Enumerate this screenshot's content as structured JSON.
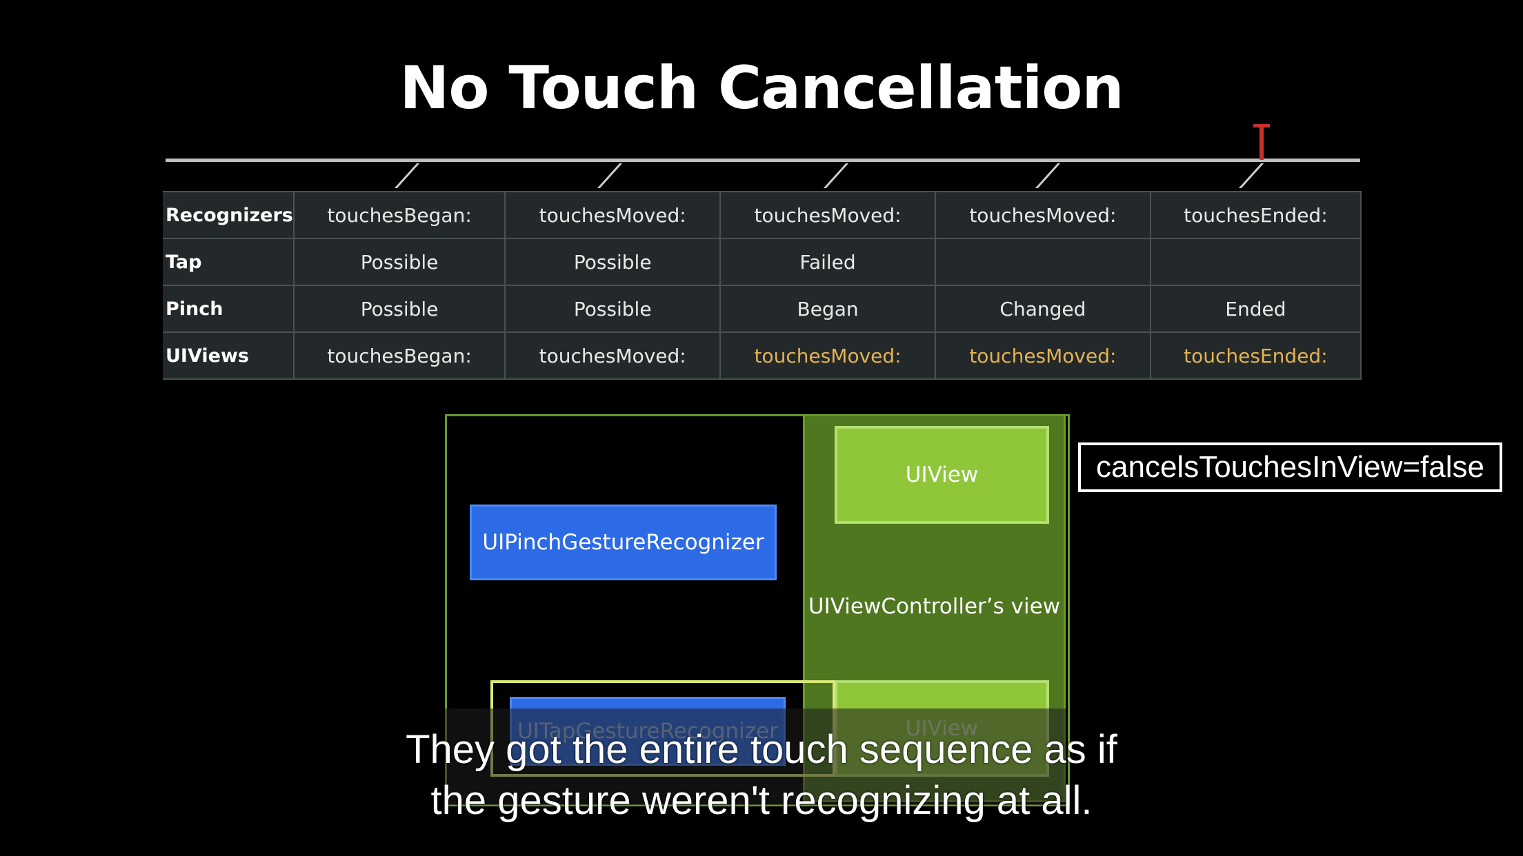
{
  "title": "No Touch Cancellation",
  "table": {
    "rows": [
      {
        "label": "Recognizers",
        "cells": [
          "touchesBegan:",
          "touchesMoved:",
          "touchesMoved:",
          "touchesMoved:",
          "touchesEnded:"
        ]
      },
      {
        "label": "Tap",
        "cells": [
          "Possible",
          "Possible",
          "Failed",
          "",
          ""
        ]
      },
      {
        "label": "Pinch",
        "cells": [
          "Possible",
          "Possible",
          "Began",
          "Changed",
          "Ended"
        ]
      },
      {
        "label": "UIViews",
        "cells": [
          "touchesBegan:",
          "touchesMoved:",
          "touchesMoved:",
          "touchesMoved:",
          "touchesEnded:"
        ]
      }
    ]
  },
  "diagram": {
    "uiview_top": "UIView",
    "uiview_bottom": "UIView",
    "pinch_recognizer": "UIPinchGestureRecognizer",
    "tap_recognizer": "UITapGestureRecognizer",
    "vc_view_label": "UIViewController’s view"
  },
  "badge": "cancelsTouchesInView=false",
  "caption": {
    "line1": "They got the entire touch sequence as if",
    "line2": "the gesture weren't recognizing at all."
  },
  "colors": {
    "highlight_text": "#e6b252",
    "timeline_marker": "#c8302b",
    "recognizer_blue": "#2d6be6",
    "uiview_green": "#8fc63a"
  }
}
